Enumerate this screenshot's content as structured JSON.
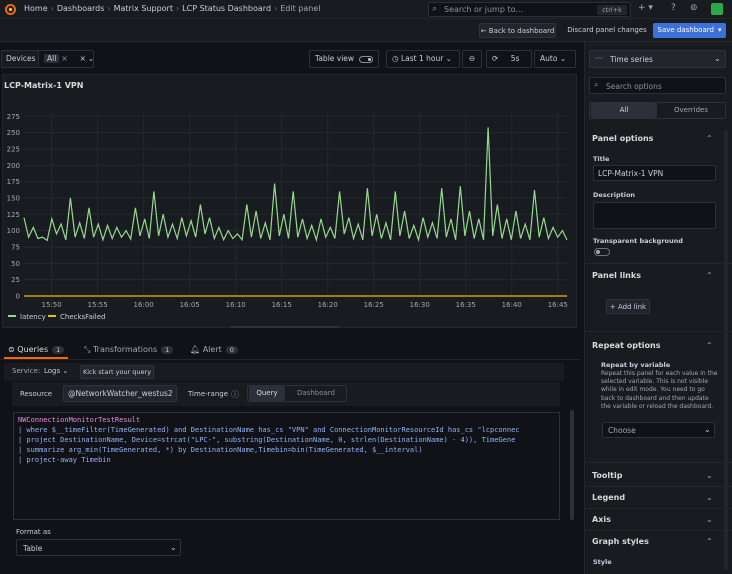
{
  "breadcrumbs": [
    "Home",
    "Dashboards",
    "Matrix Support",
    "LCP Status Dashboard",
    "Edit panel"
  ],
  "search": {
    "placeholder": "Search or jump to...",
    "shortcut": "ctrl+k"
  },
  "toolbar": {
    "back_label": "Back to dashboard",
    "discard_label": "Discard panel changes",
    "save_label": "Save dashboard"
  },
  "variables": {
    "devices_label": "Devices",
    "devices_value": "All"
  },
  "panel_controls": {
    "table_view_label": "Table view",
    "time_range": "Last 1 hour",
    "refresh_interval": "5s",
    "auto_label": "Auto"
  },
  "panel": {
    "title": "LCP-Matrix-1 VPN"
  },
  "chart_data": {
    "type": "line",
    "x": [
      "15:50",
      "15:55",
      "16:00",
      "16:05",
      "16:10",
      "16:15",
      "16:20",
      "16:25",
      "16:30",
      "16:35",
      "16:40",
      "16:45"
    ],
    "yticks": [
      0,
      25,
      50,
      75,
      100,
      125,
      150,
      175,
      200,
      225,
      250,
      275
    ],
    "ylim": [
      0,
      280
    ],
    "xlim": [
      "15:47",
      "16:46"
    ],
    "series": [
      {
        "name": "latency",
        "color": "#96d98d",
        "values": [
          [
            0,
            120
          ],
          [
            1,
            90
          ],
          [
            2,
            105
          ],
          [
            3,
            88
          ],
          [
            4,
            90
          ],
          [
            5,
            85
          ],
          [
            6,
            118
          ],
          [
            7,
            95
          ],
          [
            8,
            110
          ],
          [
            9,
            86
          ],
          [
            10,
            150
          ],
          [
            11,
            90
          ],
          [
            12,
            112
          ],
          [
            13,
            88
          ],
          [
            14,
            135
          ],
          [
            15,
            90
          ],
          [
            16,
            110
          ],
          [
            17,
            86
          ],
          [
            18,
            108
          ],
          [
            19,
            88
          ],
          [
            20,
            105
          ],
          [
            21,
            90
          ],
          [
            22,
            100
          ],
          [
            23,
            87
          ],
          [
            24,
            135
          ],
          [
            25,
            92
          ],
          [
            26,
            118
          ],
          [
            27,
            88
          ],
          [
            28,
            160
          ],
          [
            29,
            92
          ],
          [
            30,
            125
          ],
          [
            31,
            90
          ],
          [
            32,
            110
          ],
          [
            33,
            88
          ],
          [
            34,
            120
          ],
          [
            35,
            92
          ],
          [
            36,
            115
          ],
          [
            37,
            90
          ],
          [
            38,
            140
          ],
          [
            39,
            95
          ],
          [
            40,
            120
          ],
          [
            41,
            88
          ],
          [
            42,
            105
          ],
          [
            43,
            86
          ],
          [
            44,
            100
          ],
          [
            45,
            88
          ],
          [
            46,
            95
          ],
          [
            47,
            86
          ],
          [
            48,
            140
          ],
          [
            49,
            90
          ],
          [
            50,
            130
          ],
          [
            51,
            88
          ],
          [
            52,
            112
          ],
          [
            53,
            86
          ],
          [
            54,
            172
          ],
          [
            55,
            92
          ],
          [
            56,
            125
          ],
          [
            57,
            88
          ],
          [
            58,
            160
          ],
          [
            59,
            90
          ],
          [
            60,
            118
          ],
          [
            61,
            88
          ],
          [
            62,
            108
          ],
          [
            63,
            86
          ],
          [
            64,
            118
          ],
          [
            65,
            90
          ],
          [
            66,
            105
          ],
          [
            67,
            88
          ],
          [
            68,
            160
          ],
          [
            69,
            95
          ],
          [
            70,
            120
          ],
          [
            71,
            88
          ],
          [
            72,
            110
          ],
          [
            73,
            86
          ],
          [
            74,
            165
          ],
          [
            75,
            92
          ],
          [
            76,
            125
          ],
          [
            77,
            88
          ],
          [
            78,
            112
          ],
          [
            79,
            86
          ],
          [
            80,
            160
          ],
          [
            81,
            92
          ],
          [
            82,
            130
          ],
          [
            83,
            88
          ],
          [
            84,
            108
          ],
          [
            85,
            86
          ],
          [
            86,
            120
          ],
          [
            87,
            90
          ],
          [
            88,
            112
          ],
          [
            89,
            88
          ],
          [
            90,
            165
          ],
          [
            91,
            90
          ],
          [
            92,
            118
          ],
          [
            93,
            86
          ],
          [
            94,
            168
          ],
          [
            95,
            92
          ],
          [
            96,
            130
          ],
          [
            97,
            88
          ],
          [
            98,
            118
          ],
          [
            99,
            86
          ],
          [
            100,
            258
          ],
          [
            101,
            92
          ],
          [
            102,
            140
          ],
          [
            103,
            88
          ],
          [
            104,
            118
          ],
          [
            105,
            86
          ],
          [
            106,
            130
          ],
          [
            107,
            88
          ],
          [
            108,
            110
          ],
          [
            109,
            86
          ],
          [
            110,
            162
          ],
          [
            111,
            90
          ],
          [
            112,
            120
          ],
          [
            113,
            88
          ],
          [
            114,
            105
          ],
          [
            115,
            90
          ],
          [
            116,
            100
          ],
          [
            117,
            86
          ]
        ]
      },
      {
        "name": "ChecksFailed",
        "color": "#ecbb13",
        "values": [
          [
            0,
            0
          ],
          [
            117,
            0
          ]
        ]
      }
    ]
  },
  "query_tabs": [
    {
      "label": "Queries",
      "count": "1"
    },
    {
      "label": "Transformations",
      "count": "1"
    },
    {
      "label": "Alert",
      "count": "0"
    }
  ],
  "query": {
    "service_label": "Service:",
    "service_value": "Logs",
    "kickstart_label": "Kick start your query",
    "resource_label": "Resource",
    "resource_value": "@NetworkWatcher_westus2",
    "timerange_label": "Time-range",
    "mode_query": "Query",
    "mode_dashboard": "Dashboard",
    "lines": [
      "NWConnectionMonitorTestResult",
      "| where $__timeFilter(TimeGenerated) and DestinationName has_cs \"VPN\" and ConnectionMonitorResourceId has_cs \"lcpconnec",
      "| project DestinationName, Device=strcat(\"LPC-\", substring(DestinationName, 0, strlen(DestinationName) - 4)), TimeGene",
      "| summarize arg_min(TimeGenerated, *) by DestinationName,Timebin=bin(TimeGenerated, $__interval)",
      "| project-away Timebin"
    ],
    "format_label": "Format as",
    "format_value": "Table"
  },
  "options": {
    "viz_name": "Time series",
    "search_placeholder": "Search options",
    "tab_all": "All",
    "tab_overrides": "Overrides",
    "panel_options": "Panel options",
    "title_label": "Title",
    "title_value": "LCP-Matrix-1 VPN",
    "description_label": "Description",
    "transparent_label": "Transparent background",
    "panel_links": "Panel links",
    "add_link": "Add link",
    "repeat_options": "Repeat options",
    "repeat_by_label": "Repeat by variable",
    "repeat_help": "Repeat this panel for each value in the selected variable. This is not visible while in edit mode. You need to go back to dashboard and then update the variable or reload the dashboard.",
    "choose_placeholder": "Choose",
    "tooltip": "Tooltip",
    "legend": "Legend",
    "axis": "Axis",
    "graph_styles": "Graph styles",
    "style_label": "Style"
  }
}
